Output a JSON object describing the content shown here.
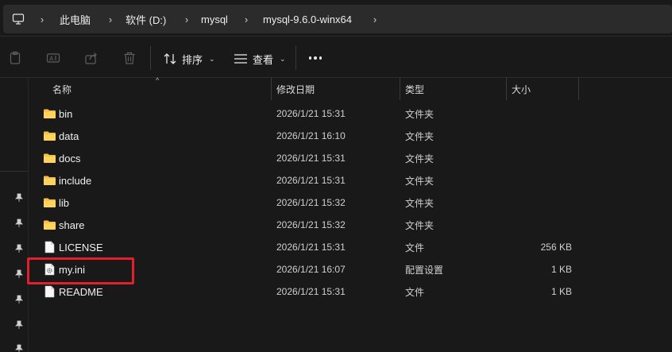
{
  "breadcrumb": [
    "此电脑",
    "软件 (D:)",
    "mysql",
    "mysql-9.6.0-winx64"
  ],
  "toolbar": {
    "sort_label": "排序",
    "view_label": "查看"
  },
  "columns": {
    "name": "名称",
    "modified": "修改日期",
    "type": "类型",
    "size": "大小"
  },
  "files": [
    {
      "name": "bin",
      "date": "2026/1/21 15:31",
      "type": "文件夹",
      "size": "",
      "icon": "folder-icon"
    },
    {
      "name": "data",
      "date": "2026/1/21 16:10",
      "type": "文件夹",
      "size": "",
      "icon": "folder-icon"
    },
    {
      "name": "docs",
      "date": "2026/1/21 15:31",
      "type": "文件夹",
      "size": "",
      "icon": "folder-icon"
    },
    {
      "name": "include",
      "date": "2026/1/21 15:31",
      "type": "文件夹",
      "size": "",
      "icon": "folder-icon"
    },
    {
      "name": "lib",
      "date": "2026/1/21 15:32",
      "type": "文件夹",
      "size": "",
      "icon": "folder-icon"
    },
    {
      "name": "share",
      "date": "2026/1/21 15:32",
      "type": "文件夹",
      "size": "",
      "icon": "folder-icon"
    },
    {
      "name": "LICENSE",
      "date": "2026/1/21 15:31",
      "type": "文件",
      "size": "256 KB",
      "icon": "file-icon"
    },
    {
      "name": "my.ini",
      "date": "2026/1/21 16:07",
      "type": "配置设置",
      "size": "1 KB",
      "icon": "settings-file-icon"
    },
    {
      "name": "README",
      "date": "2026/1/21 15:31",
      "type": "文件",
      "size": "1 KB",
      "icon": "file-icon"
    }
  ],
  "colors": {
    "highlight": "#e0202a",
    "folder": "#f5c04a"
  }
}
